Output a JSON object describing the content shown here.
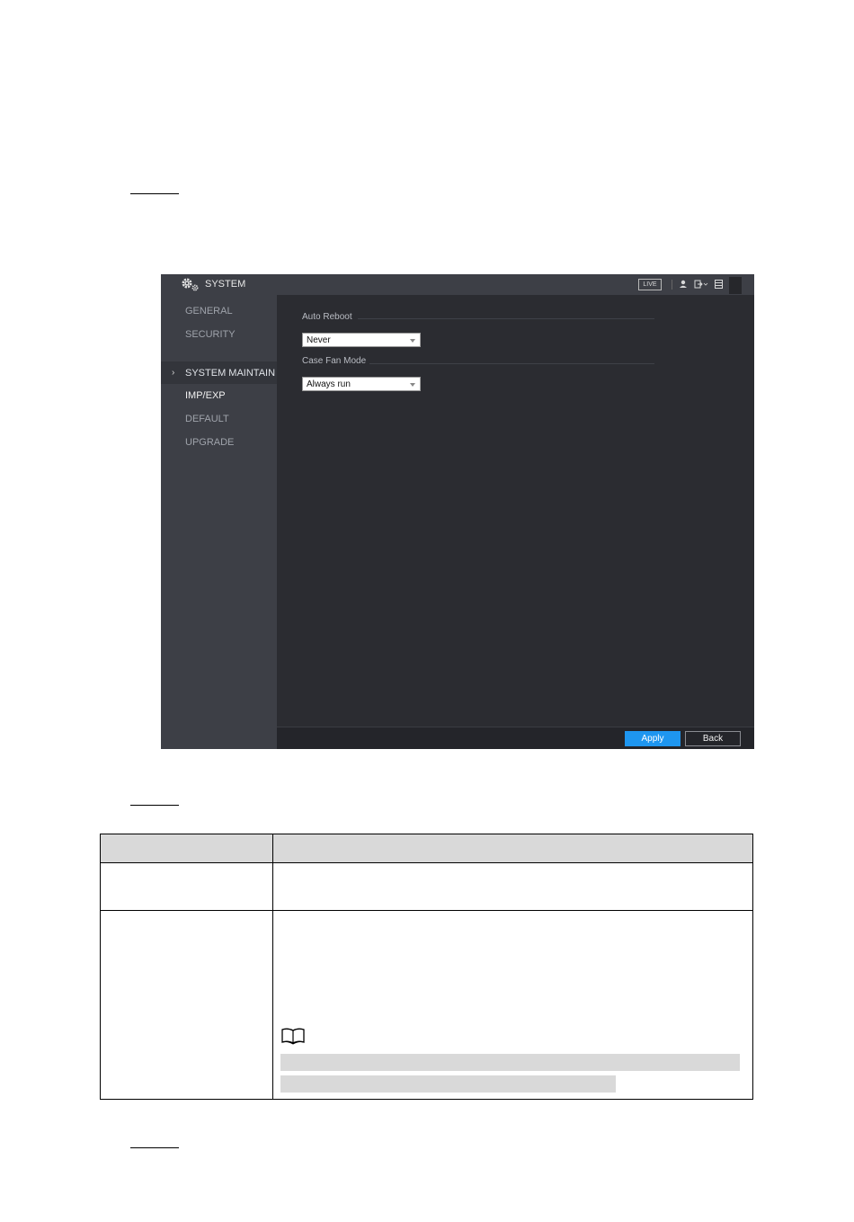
{
  "app": {
    "title": "SYSTEM",
    "header": {
      "live_label": "LIVE",
      "icons": [
        "gear-icon",
        "user-icon",
        "logout-icon",
        "layout-icon"
      ]
    },
    "sidebar": {
      "items": [
        {
          "label": "GENERAL"
        },
        {
          "label": "SECURITY"
        },
        {
          "label": "SYSTEM MAINTAIN",
          "active": true
        },
        {
          "label": "IMP/EXP"
        },
        {
          "label": "DEFAULT"
        },
        {
          "label": "UPGRADE"
        }
      ],
      "active_marker": "›"
    },
    "content": {
      "auto_reboot_label": "Auto Reboot",
      "auto_reboot_value": "Never",
      "case_fan_label": "Case Fan Mode",
      "case_fan_value": "Always run"
    },
    "footer": {
      "apply_label": "Apply",
      "back_label": "Back"
    },
    "colors": {
      "accent": "#1e96f0",
      "panel_bg": "#2b2c31",
      "sidebar_bg": "#3d3f46"
    }
  },
  "document": {
    "note_icon": "book-icon"
  }
}
